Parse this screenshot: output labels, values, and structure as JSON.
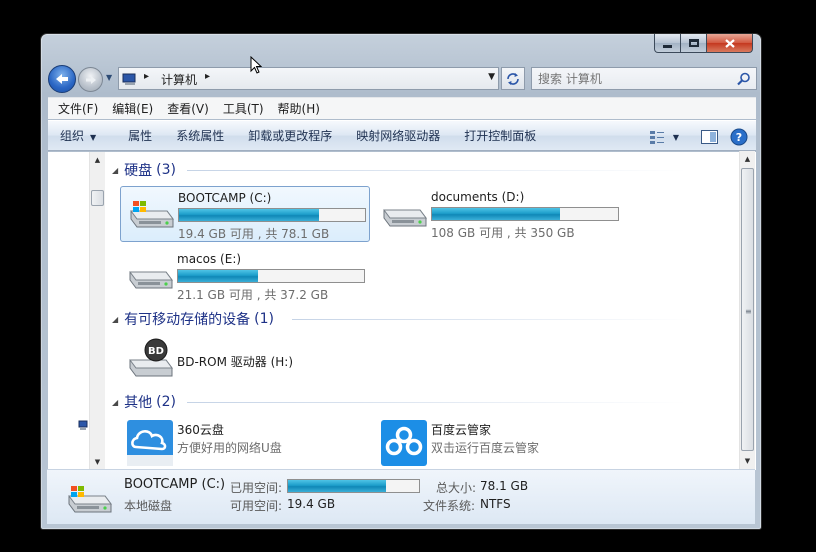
{
  "address_bar": {
    "breadcrumbs": [
      "计算机"
    ],
    "search_placeholder": "搜索 计算机"
  },
  "menu": [
    "文件(F)",
    "编辑(E)",
    "查看(V)",
    "工具(T)",
    "帮助(H)"
  ],
  "toolbar": {
    "organize": "组织",
    "items": [
      "属性",
      "系统属性",
      "卸载或更改程序",
      "映射网络驱动器",
      "打开控制面板"
    ]
  },
  "groups": [
    {
      "title": "硬盘",
      "count": "(3)"
    },
    {
      "title": "有可移动存储的设备",
      "count": "(1)"
    },
    {
      "title": "其他",
      "count": "(2)"
    }
  ],
  "drives": [
    {
      "name": "BOOTCAMP (C:)",
      "info": "19.4 GB 可用 , 共 78.1 GB",
      "used_fraction": 0.75,
      "selected": true
    },
    {
      "name": "documents (D:)",
      "info": "108 GB 可用 , 共 350 GB",
      "used_fraction": 0.69,
      "selected": false
    },
    {
      "name": "macos (E:)",
      "info": "21.1 GB 可用 , 共 37.2 GB",
      "used_fraction": 0.43,
      "selected": false
    }
  ],
  "removable": [
    {
      "name": "BD-ROM 驱动器 (H:)",
      "badge": "BD"
    }
  ],
  "others": [
    {
      "name": "360云盘",
      "sub": "方便好用的网络U盘"
    },
    {
      "name": "百度云管家",
      "sub": "双击运行百度云管家"
    }
  ],
  "details": {
    "name": "BOOTCAMP (C:)",
    "type": "本地磁盘",
    "used_label": "已用空间:",
    "used_fraction": 0.75,
    "free_label": "可用空间:",
    "free_value": "19.4 GB",
    "total_label": "总大小:",
    "total_value": "78.1 GB",
    "fs_label": "文件系统:",
    "fs_value": "NTFS"
  },
  "colors": {
    "group_header": "#1e3287",
    "bar_fill": "#1d9ecb",
    "selection_border": "#7da2ce"
  }
}
